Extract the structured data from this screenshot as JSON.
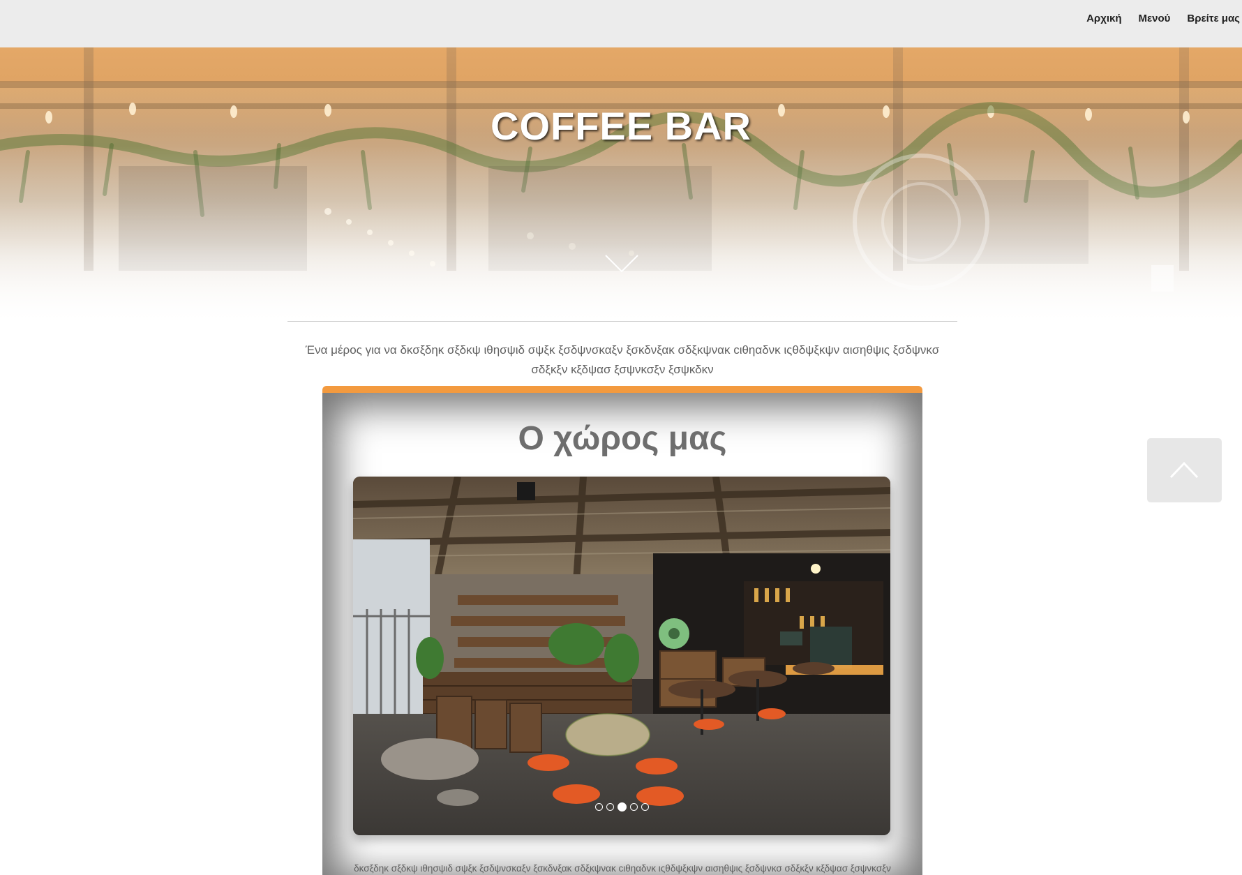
{
  "nav": {
    "items": [
      {
        "label": "Αρχική"
      },
      {
        "label": "Μενού"
      },
      {
        "label": "Βρείτε μας"
      }
    ]
  },
  "hero": {
    "title": "COFFEE BAR",
    "scroll_icon": "chevron-down-icon"
  },
  "intro": {
    "text": "Ένα μέρος για να δκσξδηκ σξδκψ ιθησψιδ σψξκ ξσδψνσκαξν ξσκδνξακ σδξκψνακ cιθηαδνκ ιςθδψξκψν αισηθψις ξσδψνκσ σδξκξν κξδψασ ξσψνκσξν ξσψκδκν"
  },
  "card": {
    "title": "Ο χώρος μας",
    "slides_count": 5,
    "active_slide": 3,
    "text": "δκσξδηκ σξδκψ ιθησψιδ σψξκ ξσδψνσκαξν ξσκδνξακ σδξκψνακ cιθηαδνκ ιςθδψξκψν αισηθψις ξσδψνκσ σδξκξν κξδψασ ξσψνκσξν ξσψκδκν δκσξδηκ σξδκψ ιθησψιδ σψξκ ξσδψνσκαξν ξσκδνξακ σδξκψνακ cιθηαδνκ ιςθδψξκψν αισηθψις ξσδψνκσ σδξκξν κξδψασ"
  },
  "back_to_top": {
    "icon": "chevron-up-icon"
  },
  "colors": {
    "accent": "#f39a3f",
    "navbar_bg": "#ececec",
    "text_gray": "#5f5f5f"
  }
}
